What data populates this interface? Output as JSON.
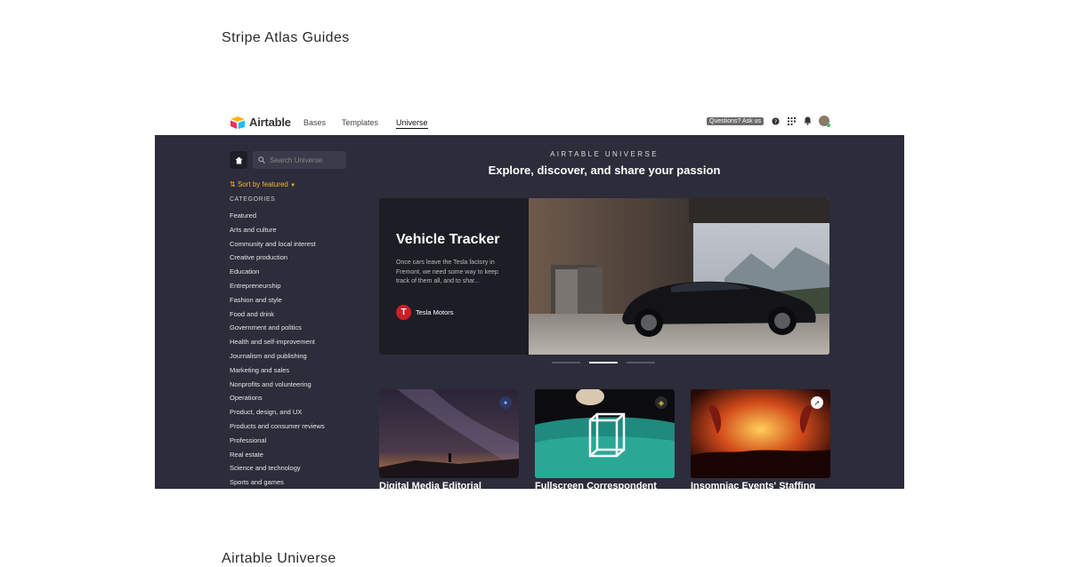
{
  "page": {
    "title": "Stripe Atlas Guides",
    "next_section_title": "Airtable Universe"
  },
  "airtable": {
    "logo_text": "Airtable",
    "nav": {
      "bases": "Bases",
      "templates": "Templates",
      "universe": "Universe"
    },
    "questions_badge": "Questions? Ask us",
    "sidebar": {
      "search_placeholder": "Search Universe",
      "sort_label": "Sort by featured",
      "categories_heading": "CATEGORIES",
      "categories": [
        "Featured",
        "Arts and culture",
        "Community and local interest",
        "Creative production",
        "Education",
        "Entrepreneurship",
        "Fashion and style",
        "Food and drink",
        "Government and politics",
        "Health and self-improvement",
        "Journalism and publishing",
        "Marketing and sales",
        "Nonprofits and volunteering",
        "Operations",
        "Product, design, and UX",
        "Products and consumer reviews",
        "Professional",
        "Real estate",
        "Science and technology",
        "Sports and games"
      ]
    },
    "hero": {
      "kicker": "AIRTABLE UNIVERSE",
      "title": "Explore, discover, and share your passion"
    },
    "featured": {
      "title": "Vehicle Tracker",
      "description": "Once cars leave the Tesla factory in Fremont, we need some way to keep track of them all, and to shar...",
      "brand": "Tesla Motors"
    },
    "carousel": {
      "count": 3,
      "active": 1
    },
    "cards": [
      {
        "title": "Digital Media Editorial"
      },
      {
        "title": "Fullscreen Correspondent"
      },
      {
        "title": "Insomniac Events' Staffing"
      }
    ]
  },
  "colors": {
    "dark_bg": "#2c2c3a",
    "accent_sort": "#f5b82e",
    "tesla_red": "#cc1f26"
  }
}
